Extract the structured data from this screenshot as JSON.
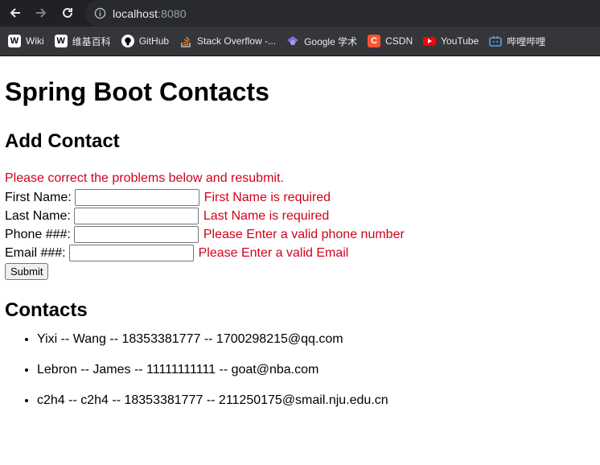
{
  "browser": {
    "url_host": "localhost",
    "url_port": ":8080",
    "bookmarks": [
      {
        "label": "Wiki",
        "icon": "wikipedia-icon"
      },
      {
        "label": "维基百科",
        "icon": "wikipedia-icon"
      },
      {
        "label": "GitHub",
        "icon": "github-icon"
      },
      {
        "label": "Stack Overflow -...",
        "icon": "stackoverflow-icon"
      },
      {
        "label": "Google 学术",
        "icon": "google-scholar-icon"
      },
      {
        "label": "CSDN",
        "icon": "csdn-icon"
      },
      {
        "label": "YouTube",
        "icon": "youtube-icon"
      },
      {
        "label": "哔哩哔哩",
        "icon": "bilibili-icon"
      }
    ]
  },
  "page": {
    "title": "Spring Boot Contacts",
    "add_heading": "Add Contact",
    "error_banner": "Please correct the problems below and resubmit.",
    "form": {
      "first_name": {
        "label": "First Name:",
        "value": "",
        "error": "First Name is required"
      },
      "last_name": {
        "label": "Last Name:",
        "value": "",
        "error": "Last Name is required"
      },
      "phone": {
        "label": "Phone ###:",
        "value": "",
        "error": "Please Enter a valid phone number"
      },
      "email": {
        "label": "Email ###:",
        "value": "",
        "error": "Please Enter a valid Email"
      },
      "submit_label": "Submit"
    },
    "contacts_heading": "Contacts",
    "contacts": [
      "Yixi -- Wang -- 18353381777 -- 1700298215@qq.com",
      "Lebron -- James -- 11111111111 -- goat@nba.com",
      "c2h4 -- c2h4 -- 18353381777 -- 211250175@smail.nju.edu.cn"
    ]
  }
}
